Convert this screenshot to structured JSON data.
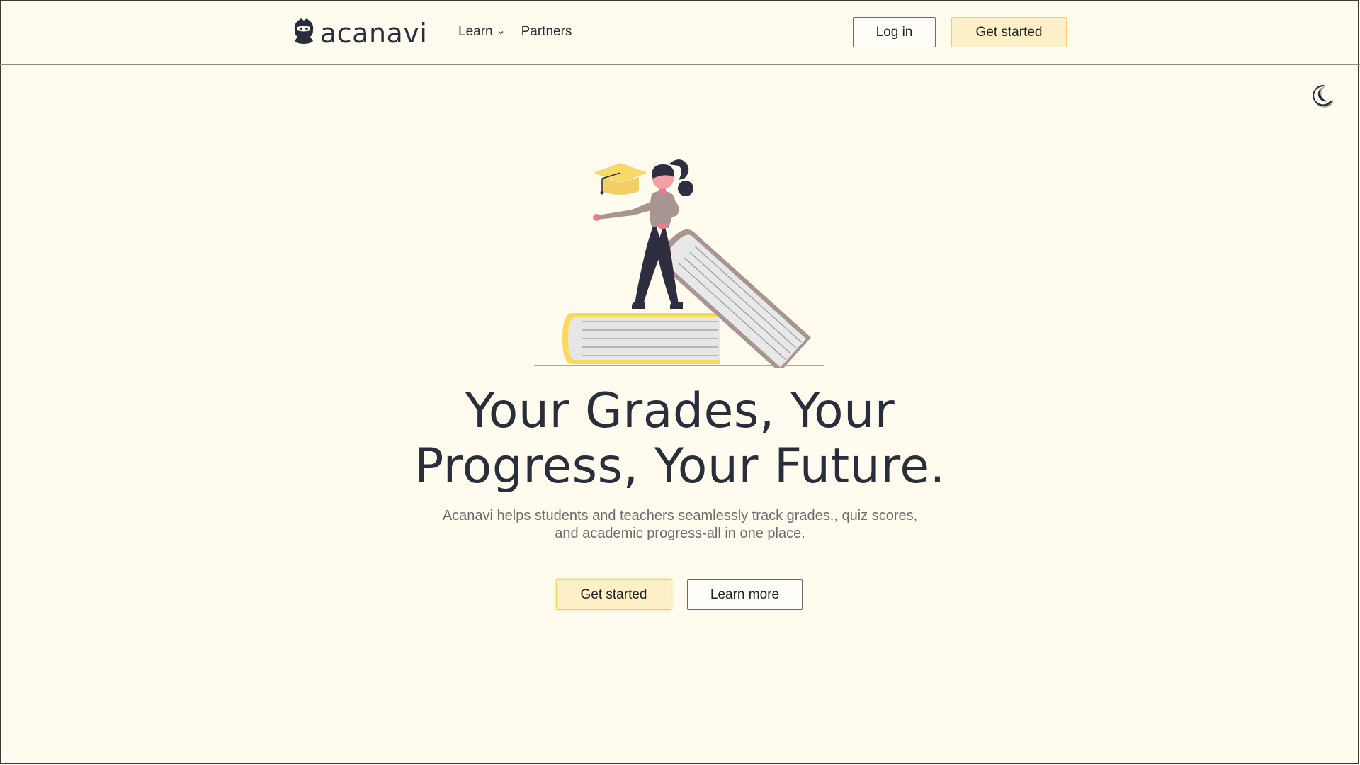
{
  "brand": {
    "name": "acanavi"
  },
  "nav": {
    "items": [
      {
        "label": "Learn",
        "has_dropdown": true
      },
      {
        "label": "Partners",
        "has_dropdown": false
      }
    ],
    "login_label": "Log in",
    "get_started_label": "Get started"
  },
  "theme_toggle": {
    "icon": "moon-icon"
  },
  "hero": {
    "title": "Your Grades, Your Progress, Your Future.",
    "subtitle": "Acanavi helps students and teachers seamlessly track grades., quiz scores, and academic progress-all in one place.",
    "primary_cta": "Get started",
    "secondary_cta": "Learn more"
  },
  "colors": {
    "background": "#fffbef",
    "text": "#2a2d3a",
    "accent": "#f5d35c",
    "button_primary_bg": "#fdefc6",
    "muted_text": "#6b6b6b"
  }
}
